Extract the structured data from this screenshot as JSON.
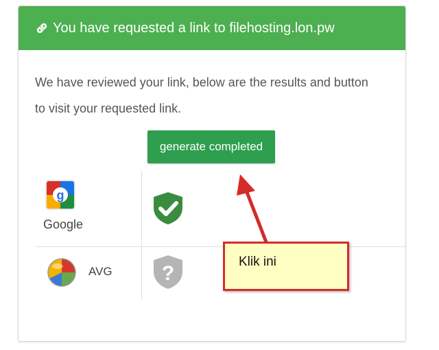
{
  "card": {
    "title": "You have requested a link to filehosting.lon.pw",
    "description": "We have reviewed your link, below are the results and button to visit your requested link.",
    "button_label": "generate completed"
  },
  "scanners": [
    {
      "name": "Google",
      "status_icon": "shield-check-icon"
    },
    {
      "name": "AVG",
      "status_icon": "shield-question-icon"
    }
  ],
  "annotation": {
    "label": "Klik ini"
  },
  "colors": {
    "header": "#4caf50",
    "button": "#2e9e4f",
    "shield_ok": "#3a8c3e",
    "shield_unknown": "#b5b5b5",
    "note_bg": "#ffffc4",
    "note_border": "#d42b2b"
  }
}
